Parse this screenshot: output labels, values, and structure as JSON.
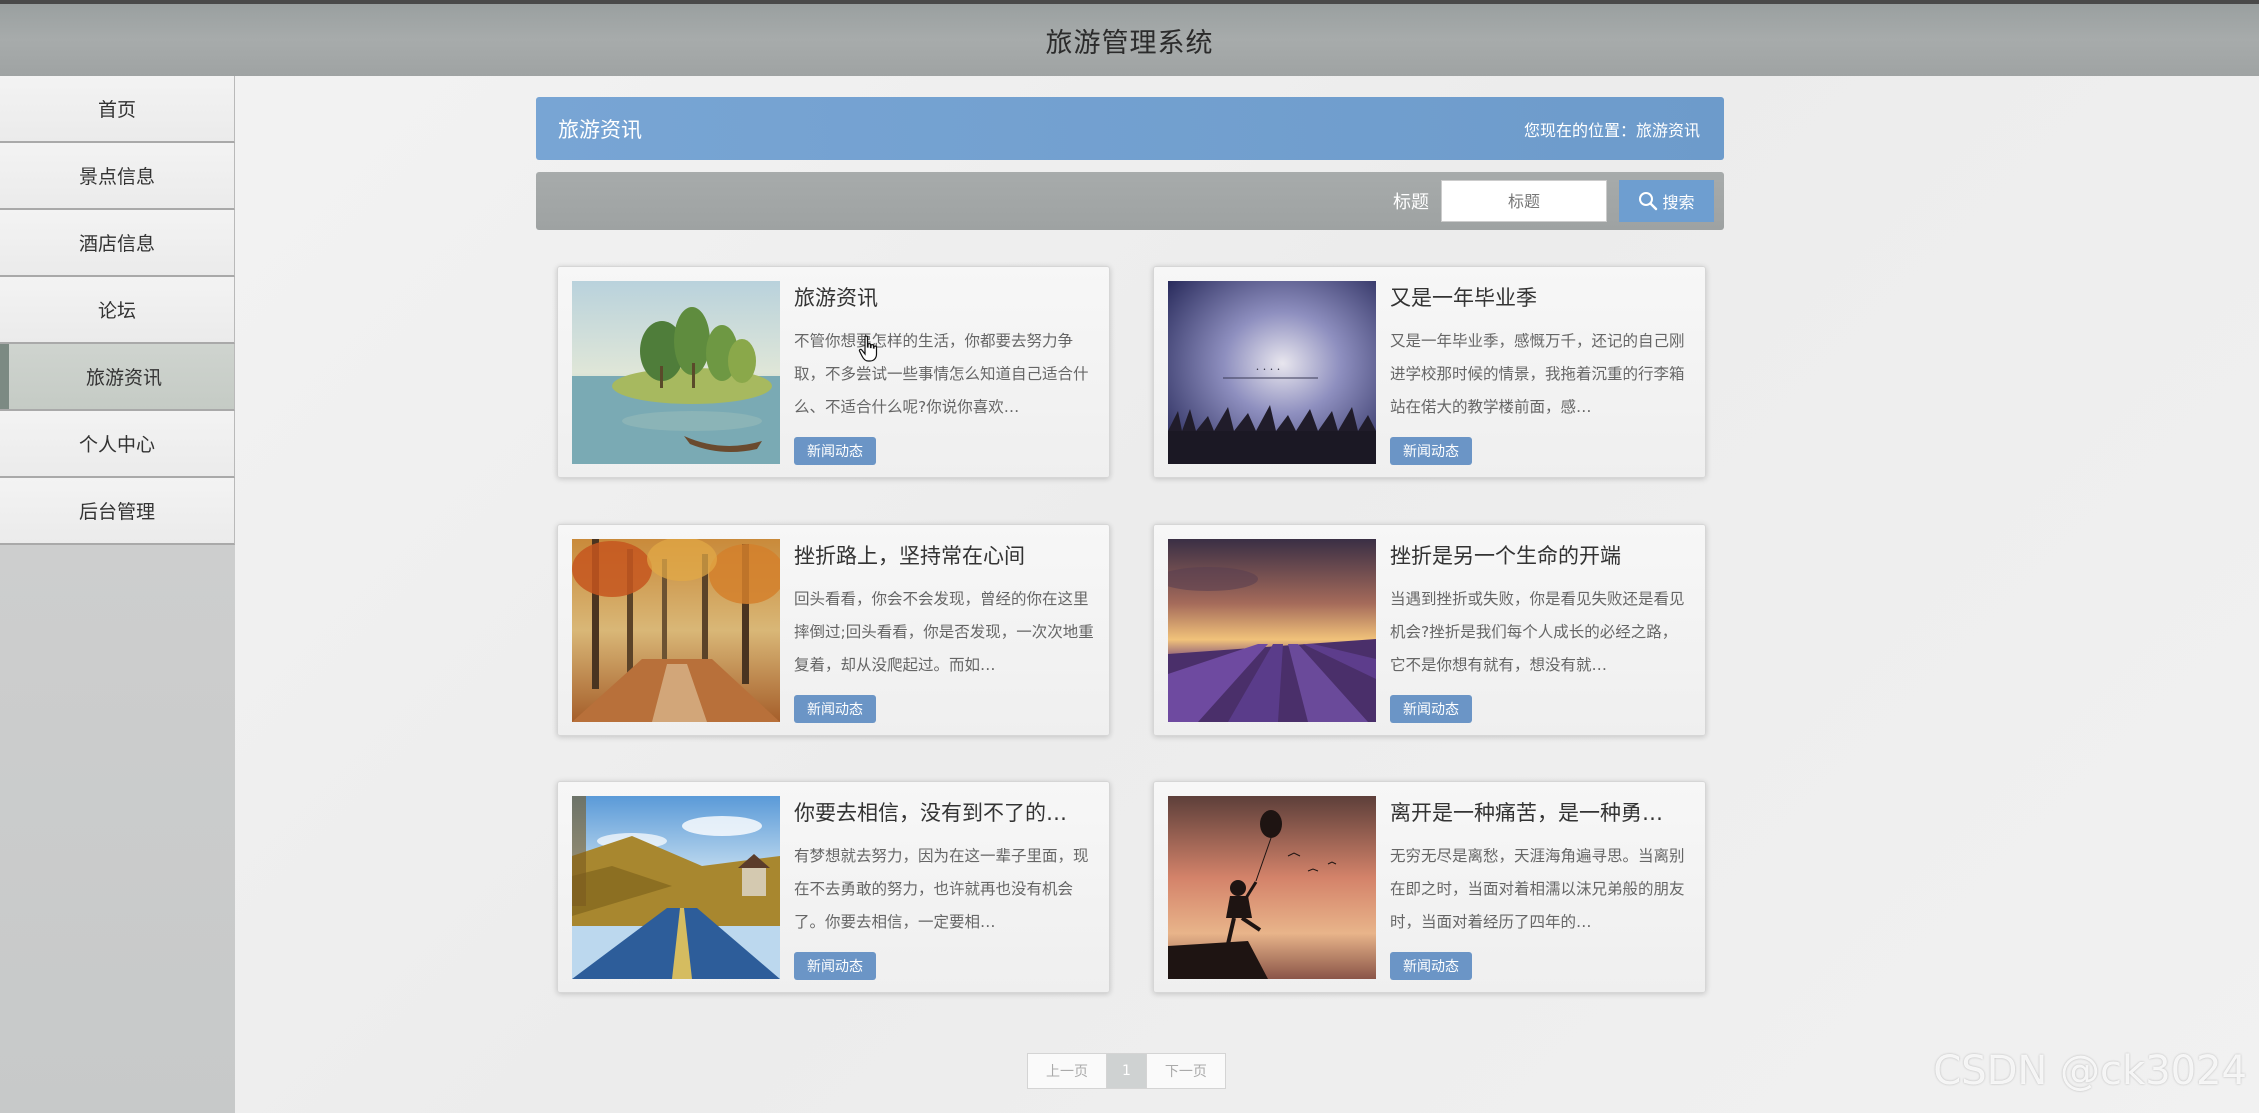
{
  "app": {
    "title": "旅游管理系统"
  },
  "sidebar": {
    "items": [
      {
        "label": "首页"
      },
      {
        "label": "景点信息"
      },
      {
        "label": "酒店信息"
      },
      {
        "label": "论坛"
      },
      {
        "label": "旅游资讯",
        "active": true
      },
      {
        "label": "个人中心"
      },
      {
        "label": "后台管理"
      }
    ]
  },
  "header": {
    "title": "旅游资讯",
    "breadcrumb": "您现在的位置：旅游资讯"
  },
  "search": {
    "label": "标题",
    "placeholder": "标题",
    "button_label": "搜索"
  },
  "articles": [
    {
      "title": "旅游资讯",
      "desc": "不管你想要怎样的生活，你都要去努力争取，不多尝试一些事情怎么知道自己适合什么、不适合什么呢?你说你喜欢…",
      "tag": "新闻动态",
      "image": "lake-trees-painting"
    },
    {
      "title": "又是一年毕业季",
      "desc": "又是一年毕业季，感慨万千，还记的自己刚进学校那时候的情景，我拖着沉重的行李箱站在偌大的教学楼前面，感…",
      "tag": "新闻动态",
      "image": "night-sky-grass"
    },
    {
      "title": "挫折路上，坚持常在心间",
      "desc": "回头看看，你会不会发现，曾经的你在这里摔倒过;回头看看，你是否发现，一次次地重复着，却从没爬起过。而如…",
      "tag": "新闻动态",
      "image": "autumn-forest"
    },
    {
      "title": "挫折是另一个生命的开端",
      "desc": "当遇到挫折或失败，你是看见失败还是看见机会?挫折是我们每个人成长的必经之路，它不是你想有就有，想没有就…",
      "tag": "新闻动态",
      "image": "lavender-field-sunset"
    },
    {
      "title": "你要去相信，没有到不了的…",
      "desc": "有梦想就去努力，因为在这一辈子里面，现在不去勇敢的努力，也许就再也没有机会了。你要去相信，一定要相…",
      "tag": "新闻动态",
      "image": "mountain-road"
    },
    {
      "title": "离开是一种痛苦，是一种勇…",
      "desc": "无穷无尽是离愁，天涯海角遍寻思。当离别在即之时，当面对着相濡以沫兄弟般的朋友时，当面对着经历了四年的…",
      "tag": "新闻动态",
      "image": "girl-balloon-sunset"
    }
  ],
  "pager": {
    "prev": "上一页",
    "current": "1",
    "next": "下一页"
  },
  "watermark": "CSDN @ck3024"
}
